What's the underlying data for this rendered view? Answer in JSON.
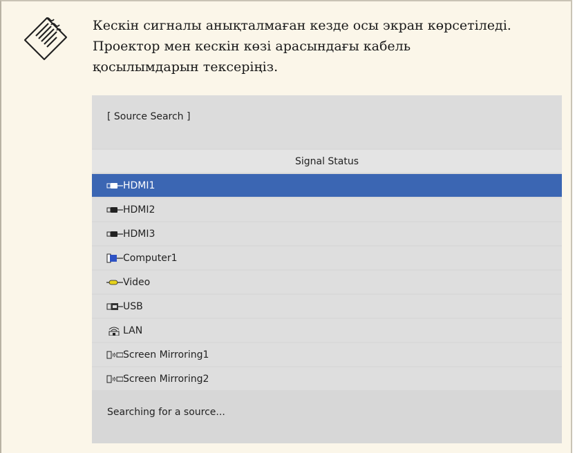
{
  "note": {
    "icon": "notepad-icon",
    "lines": [
      "Кескін сигналы анықталмаған кезде осы экран көрсетіледі.",
      "Проектор мен кескін көзі арасындағы кабель",
      "қосылымдарын тексеріңіз."
    ]
  },
  "osd": {
    "title": "[ Source Search ]",
    "signal_status": "Signal Status",
    "selected_index": 0,
    "sources": [
      {
        "label": "HDMI1",
        "icon": "hdmi-icon"
      },
      {
        "label": "HDMI2",
        "icon": "hdmi-icon"
      },
      {
        "label": "HDMI3",
        "icon": "hdmi-icon"
      },
      {
        "label": "Computer1",
        "icon": "computer-vga-icon"
      },
      {
        "label": "Video",
        "icon": "video-rca-icon"
      },
      {
        "label": "USB",
        "icon": "usb-icon"
      },
      {
        "label": "LAN",
        "icon": "lan-wireless-icon"
      },
      {
        "label": "Screen Mirroring1",
        "icon": "screen-mirroring-icon"
      },
      {
        "label": "Screen Mirroring2",
        "icon": "screen-mirroring-icon"
      }
    ],
    "status": "Searching for a source...",
    "colors": {
      "selected": "#3b66b3",
      "panel": "#d9d9d9",
      "note_bg": "#fbf6e9"
    }
  }
}
